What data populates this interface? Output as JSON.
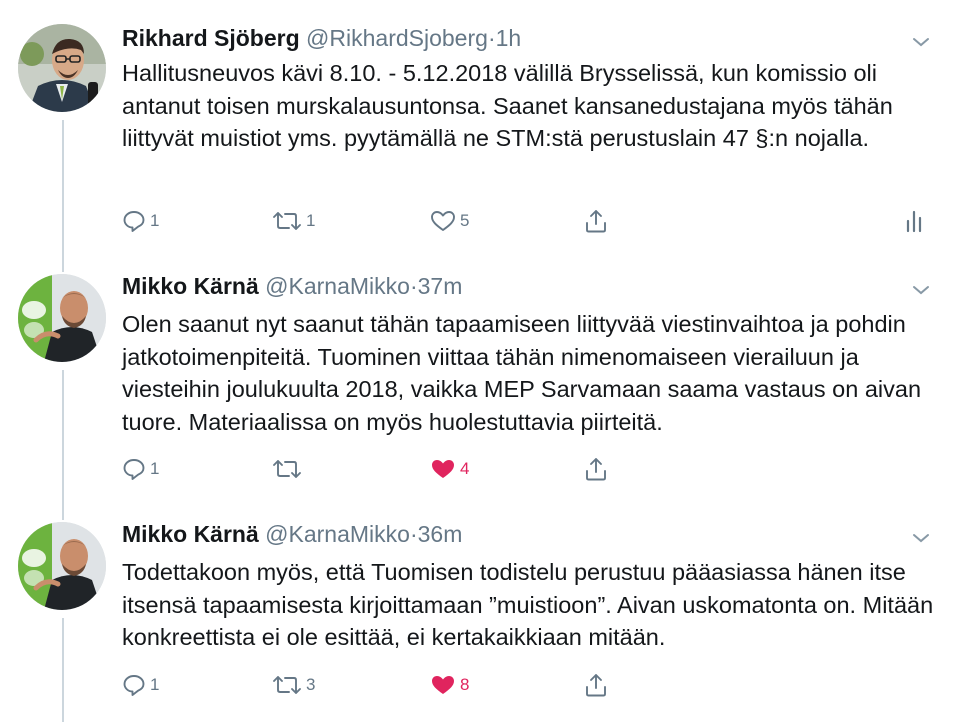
{
  "tweets": [
    {
      "author_name": "Rikhard Sjöberg",
      "handle": "@RikhardSjoberg",
      "separator": "·",
      "time": "1h",
      "text": "Hallitusneuvos kävi 8.10. - 5.12.2018 välillä Brysselissä, kun komissio oli antanut toisen murskalausuntonsa. Saanet kansanedustajana myös tähän liittyvät muistiot yms. pyytämällä ne STM:stä perustuslain 47 §:n nojalla.",
      "replies": "1",
      "retweets": "1",
      "likes": "5",
      "liked": false,
      "show_analytics": true
    },
    {
      "author_name": "Mikko Kärnä",
      "handle": "@KarnaMikko",
      "separator": "·",
      "time": "37m",
      "text": "Olen saanut nyt saanut tähän tapaamiseen liittyvää viestinvaihtoa ja pohdin jatkotoimenpiteitä. Tuominen viittaa tähän nimenomaiseen vierailuun ja viesteihin joulukuulta 2018, vaikka MEP Sarvamaan saama vastaus on aivan tuore. Materiaalissa on myös huolestuttavia piirteitä.",
      "replies": "1",
      "retweets": "",
      "likes": "4",
      "liked": true,
      "show_analytics": false
    },
    {
      "author_name": "Mikko Kärnä",
      "handle": "@KarnaMikko",
      "separator": "·",
      "time": "36m",
      "text": "Todettakoon myös, että Tuomisen todistelu perustuu pääasiassa hänen itse itsensä tapaamisesta kirjoittamaan ”muistioon”. Aivan uskomatonta on. Mitään konkreettista ei ole esittää, ei kertakaikkiaan mitään.",
      "replies": "1",
      "retweets": "3",
      "likes": "8",
      "liked": true,
      "show_analytics": false
    }
  ],
  "icons": {
    "reply": "reply-icon",
    "retweet": "retweet-icon",
    "like": "heart-icon",
    "share": "share-icon",
    "analytics": "analytics-icon",
    "more": "chevron-down-icon"
  },
  "colors": {
    "text": "#14171a",
    "muted": "#657786",
    "like_active": "#e0245e",
    "thread_line": "#ccd6dd"
  }
}
